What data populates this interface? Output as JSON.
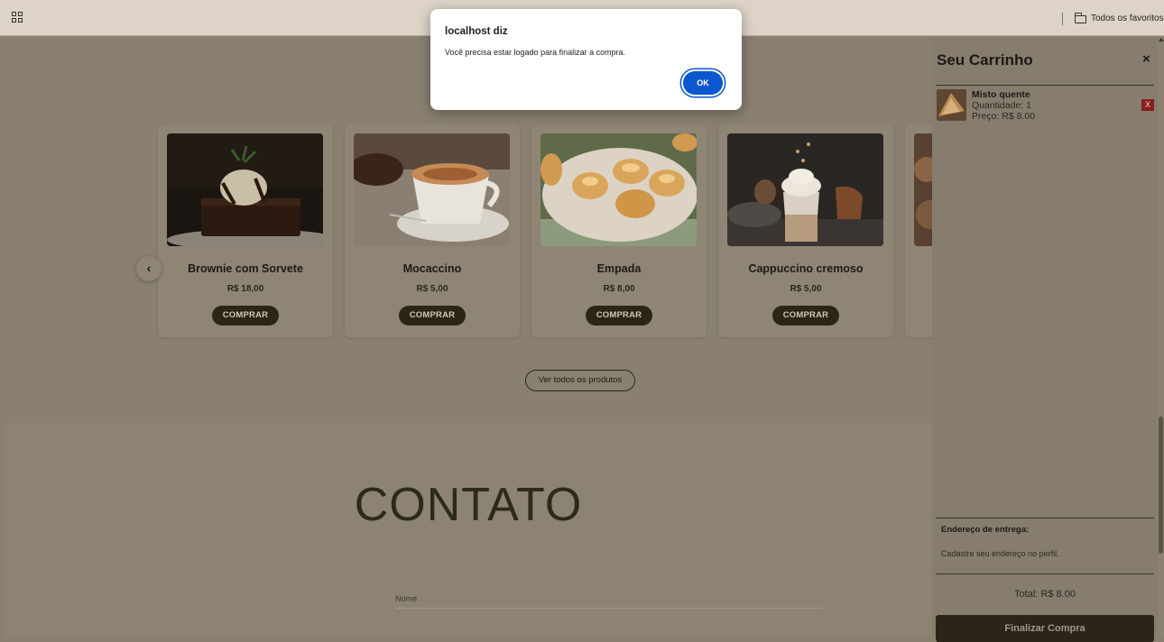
{
  "browser": {
    "bookmarks_folder": "Todos os favoritos"
  },
  "products": [
    {
      "name": "Brownie com Sorvete",
      "price": "R$ 18,00",
      "button": "COMPRAR"
    },
    {
      "name": "Mocaccino",
      "price": "R$ 5,00",
      "button": "COMPRAR"
    },
    {
      "name": "Empada",
      "price": "R$ 8,00",
      "button": "COMPRAR"
    },
    {
      "name": "Cappuccino cremoso",
      "price": "R$ 5,00",
      "button": "COMPRAR"
    }
  ],
  "carousel": {
    "prev_glyph": "‹"
  },
  "view_all_label": "Ver todos os produtos",
  "contact": {
    "heading": "CONTATO",
    "name_label": "Nome"
  },
  "cart": {
    "title": "Seu Carrinho",
    "close_glyph": "×",
    "items": [
      {
        "name": "Misto quente",
        "quantity": "Quantidade: 1",
        "price": "Preço: R$ 8.00",
        "remove": "X"
      }
    ],
    "address_title": "Endereço de entrega:",
    "address_text": "Cadastre seu endereço no perfil.",
    "total": "Total: R$ 8.00",
    "checkout_button": "Finalizar Compra"
  },
  "dialog": {
    "title": "localhost diz",
    "message": "Você precisa estar logado para finalizar a compra.",
    "ok_label": "OK"
  },
  "colors": {
    "accent_button": "#2d2513",
    "dialog_ok": "#0b57d0",
    "remove_button": "#8a1e1c"
  }
}
